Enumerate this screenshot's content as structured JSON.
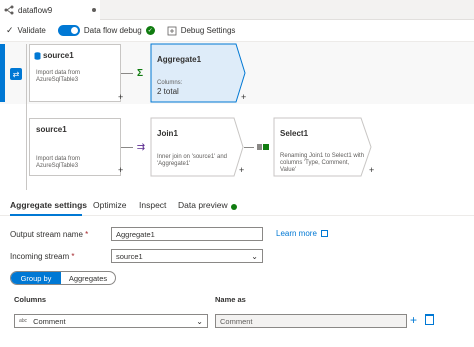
{
  "tab": {
    "title": "dataflow9",
    "icon": "dataflow-icon"
  },
  "toolbar": {
    "validate": "Validate",
    "debug_toggle": "Data flow debug",
    "debug_settings": "Debug Settings"
  },
  "canvas": {
    "row1": {
      "source": {
        "title": "source1",
        "desc1": "Import data from",
        "desc2": "AzureSqlTable3"
      },
      "aggregate": {
        "title": "Aggregate1",
        "sub": "Columns:",
        "value": "2 total"
      }
    },
    "row2": {
      "source": {
        "title": "source1",
        "desc1": "Import data from",
        "desc2": "AzureSqlTable3"
      },
      "join": {
        "title": "Join1",
        "desc1": "Inner join on 'source1' and",
        "desc2": "'Aggregate1'"
      },
      "select": {
        "title": "Select1",
        "desc1": "Renaming Join1 to Select1 with",
        "desc2": "columns 'Type, Comment,",
        "desc3": "Value'"
      }
    },
    "plus": "+"
  },
  "panel": {
    "tabs": [
      "Aggregate settings",
      "Optimize",
      "Inspect",
      "Data preview"
    ],
    "output_stream_label": "Output stream name",
    "output_stream_value": "Aggregate1",
    "incoming_stream_label": "Incoming stream",
    "incoming_stream_value": "source1",
    "required": "*",
    "learn_more": "Learn more",
    "group_by": "Group by",
    "aggregates": "Aggregates",
    "columns_header": "Columns",
    "name_as_header": "Name as",
    "column_type": "abc",
    "column_value": "Comment",
    "name_as_value": "Comment"
  },
  "colors": {
    "accent": "#0078d4",
    "success": "#107c10"
  }
}
